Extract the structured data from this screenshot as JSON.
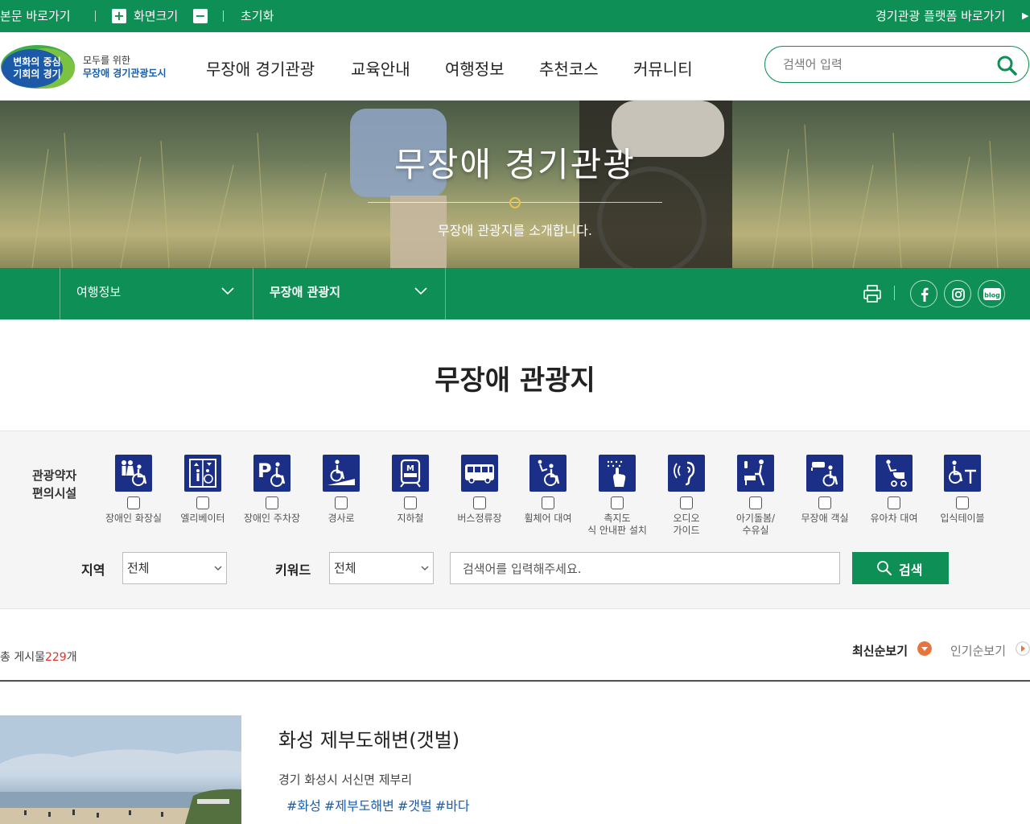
{
  "utility": {
    "skip_to_content": "본문 바로가기",
    "font_size": "화면크기",
    "reset": "초기화",
    "platform_link": "경기관광 플랫폼 바로가기"
  },
  "logo": {
    "mark_line1": "변화의 중심",
    "mark_line2": "기회의 경기",
    "line1": "모두를 위한",
    "line2": "무장애 경기관광도시"
  },
  "nav": [
    "무장애 경기관광",
    "교육안내",
    "여행정보",
    "추천코스",
    "커뮤니티"
  ],
  "search": {
    "placeholder": "검색어 입력"
  },
  "hero": {
    "title": "무장애 경기관광",
    "subtitle": "무장애 관광지를 소개합니다."
  },
  "location": {
    "depth1": "여행정보",
    "depth2": "무장애 관광지",
    "blog_label": "blog"
  },
  "page_title": "무장애 관광지",
  "filter": {
    "title": "관광약자 편의시설",
    "facilities": [
      {
        "label": "장애인 화장실",
        "icon": "accessible-toilet-icon"
      },
      {
        "label": "엘리베이터",
        "icon": "elevator-icon"
      },
      {
        "label": "장애인 주차장",
        "icon": "accessible-parking-icon"
      },
      {
        "label": "경사로",
        "icon": "ramp-icon"
      },
      {
        "label": "지하철",
        "icon": "subway-icon"
      },
      {
        "label": "버스정류장",
        "icon": "bus-stop-icon"
      },
      {
        "label": "휠체어 대여",
        "icon": "wheelchair-rental-icon"
      },
      {
        "label": "촉지도식 안내판 설치",
        "icon": "tactile-map-icon"
      },
      {
        "label": "오디오 가이드",
        "icon": "audio-guide-icon"
      },
      {
        "label": "아기돌봄/ 수유실",
        "icon": "nursing-room-icon"
      },
      {
        "label": "무장애 객실",
        "icon": "accessible-room-icon"
      },
      {
        "label": "유아차 대여",
        "icon": "stroller-rental-icon"
      },
      {
        "label": "입식테이블",
        "icon": "standing-table-icon"
      }
    ],
    "region_label": "지역",
    "region_value": "전체",
    "keyword_label": "키워드",
    "keyword_value": "전체",
    "keyword_placeholder": "검색어를 입력해주세요.",
    "search_button": "검색"
  },
  "list": {
    "total_prefix": "총 게시물",
    "total_count": "229",
    "total_suffix": "개",
    "sort_latest": "최신순보기",
    "sort_popular": "인기순보기",
    "items": [
      {
        "title": "화성 제부도해변(갯벌)",
        "address": "경기 화성시 서신면 제부리",
        "tags": [
          "#화성",
          "#제부도해변",
          "#갯벌",
          "#바다"
        ]
      }
    ]
  },
  "colors": {
    "brand_green": "#0e8f55",
    "icon_navy": "#1c2f86",
    "count_red": "#d9342b",
    "sort_orange": "#e8743c",
    "tag_blue": "#1a5ea8"
  }
}
